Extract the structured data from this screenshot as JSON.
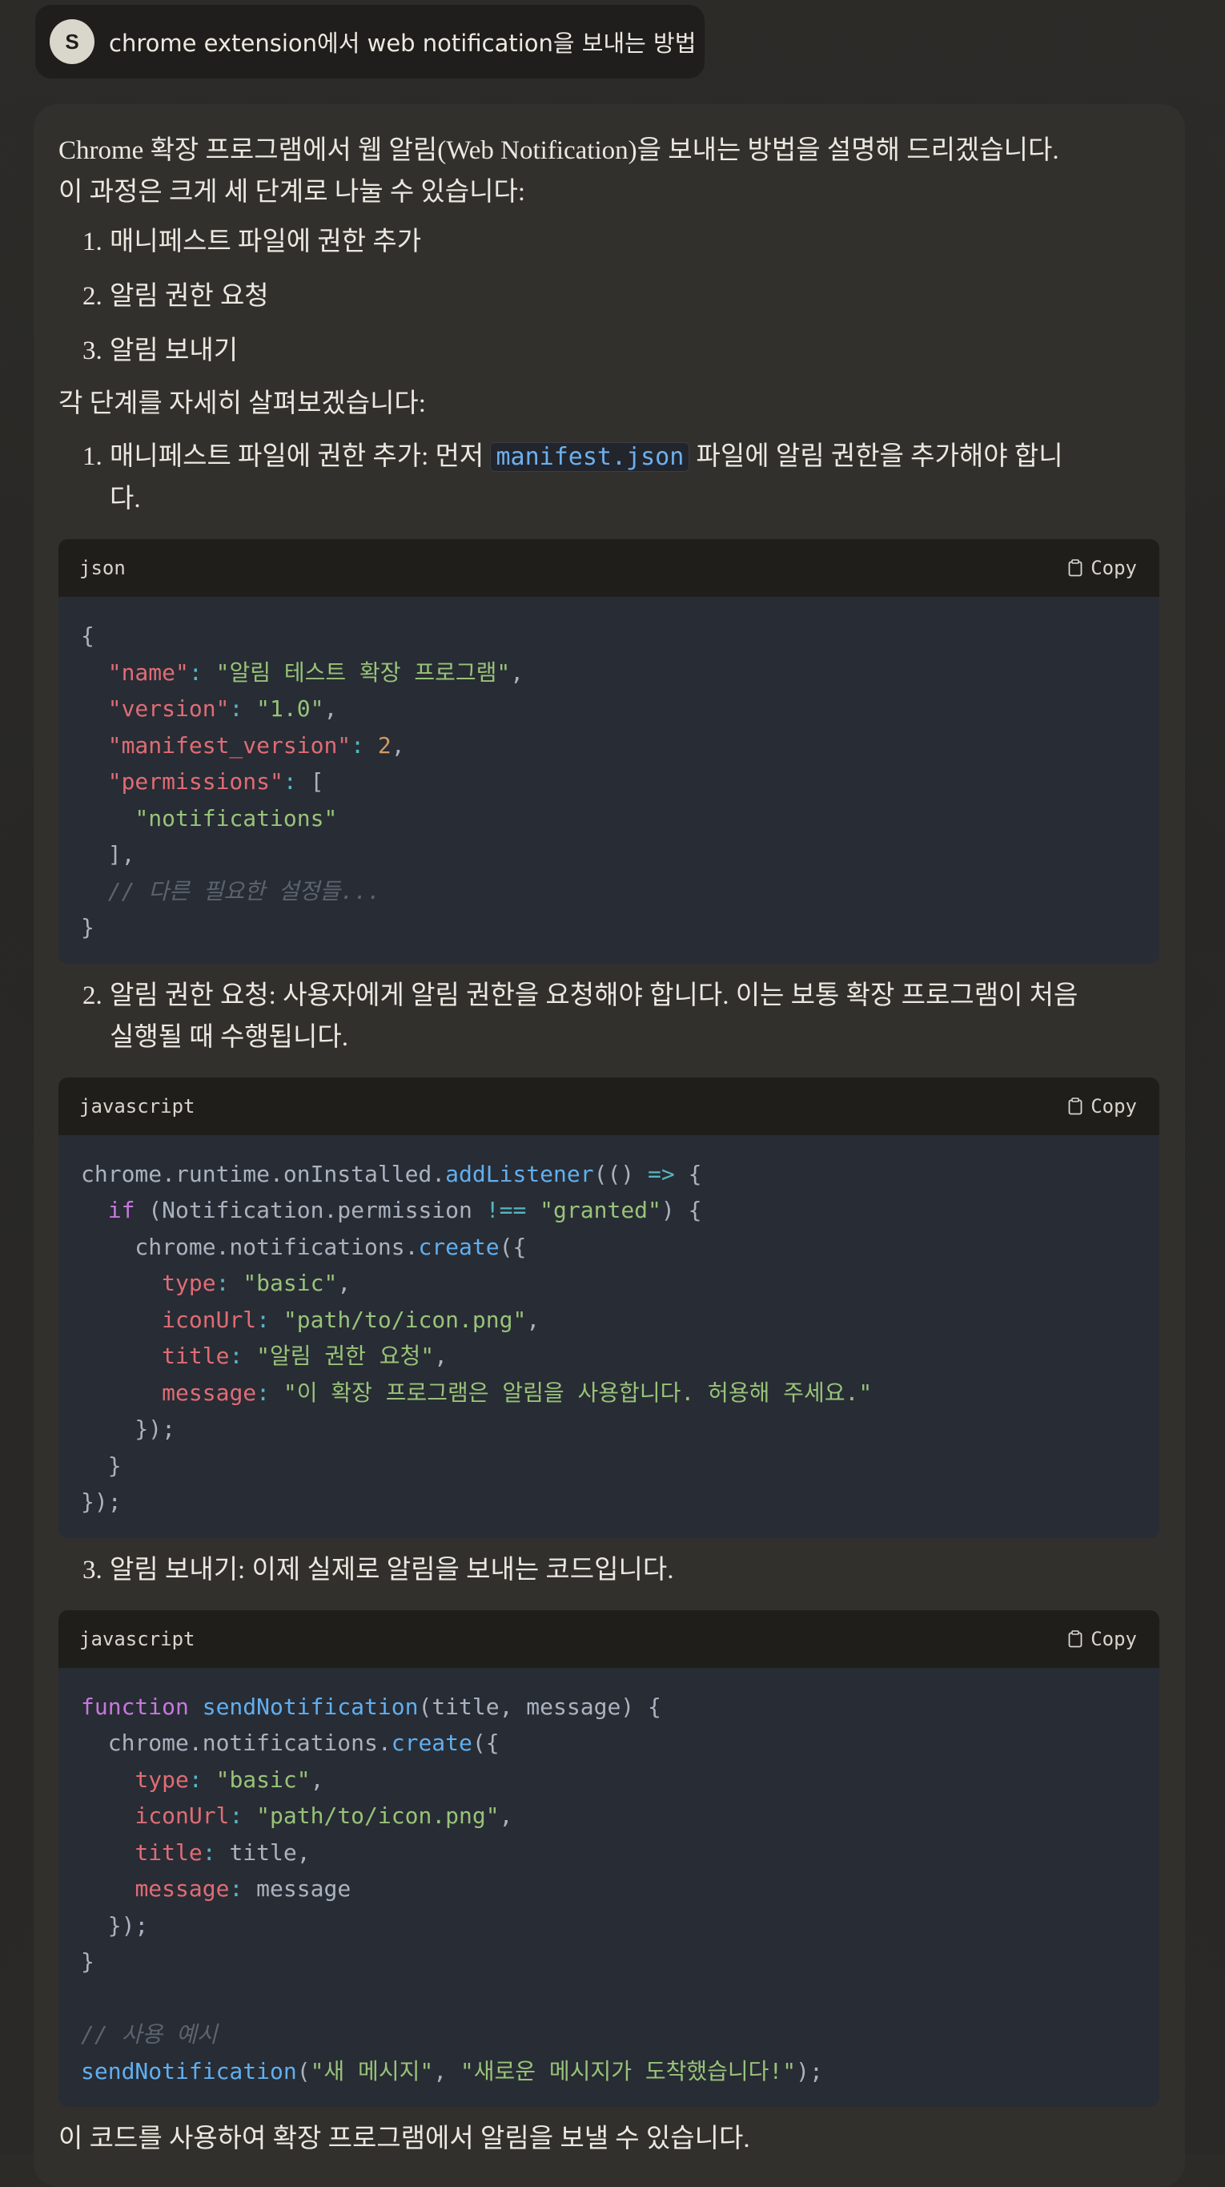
{
  "user_message": {
    "avatar_initial": "S",
    "text": "chrome extension에서 web notification을 보내는 방법"
  },
  "assistant": {
    "intro_line1": "Chrome 확장 프로그램에서 웹 알림(Web Notification)을 보내는 방법을 설명해 드리겠습니다.",
    "intro_line2": "이 과정은 크게 세 단계로 나눌 수 있습니다:",
    "overview": [
      {
        "num": "1.",
        "text": "매니페스트 파일에 권한 추가"
      },
      {
        "num": "2.",
        "text": "알림 권한 요청"
      },
      {
        "num": "3.",
        "text": "알림 보내기"
      }
    ],
    "detail_intro": "각 단계를 자세히 살펴보겠습니다:",
    "step1": {
      "num": "1.",
      "text_before": "매니페스트 파일에 권한 추가: 먼저",
      "inline_code": "manifest.json",
      "text_after": "파일에 알림 권한을 추가해야 합니",
      "text_wrap": "다."
    },
    "step2": {
      "num": "2.",
      "text_line1": "알림 권한 요청: 사용자에게 알림 권한을 요청해야 합니다. 이는 보통 확장 프로그램이 처음",
      "text_line2": "실행될 때 수행됩니다."
    },
    "step3": {
      "num": "3.",
      "text": "알림 보내기: 이제 실제로 알림을 보내는 코드입니다."
    },
    "bottom_partial": "이 코드를 사용하여 확장 프로그램에서 알림을 보낼 수 있습니다."
  },
  "code_blocks": [
    {
      "language": "json",
      "copy_label": "Copy",
      "lines": [
        [
          [
            "t-pl",
            "{"
          ]
        ],
        [
          [
            "t-pl",
            "  "
          ],
          [
            "t-key",
            "\"name\""
          ],
          [
            "t-op",
            ":"
          ],
          [
            "t-pl",
            " "
          ],
          [
            "t-str",
            "\"알림 테스트 확장 프로그램\""
          ],
          [
            "t-pl",
            ","
          ]
        ],
        [
          [
            "t-pl",
            "  "
          ],
          [
            "t-key",
            "\"version\""
          ],
          [
            "t-op",
            ":"
          ],
          [
            "t-pl",
            " "
          ],
          [
            "t-str",
            "\"1.0\""
          ],
          [
            "t-pl",
            ","
          ]
        ],
        [
          [
            "t-pl",
            "  "
          ],
          [
            "t-key",
            "\"manifest_version\""
          ],
          [
            "t-op",
            ":"
          ],
          [
            "t-pl",
            " "
          ],
          [
            "t-num",
            "2"
          ],
          [
            "t-pl",
            ","
          ]
        ],
        [
          [
            "t-pl",
            "  "
          ],
          [
            "t-key",
            "\"permissions\""
          ],
          [
            "t-op",
            ":"
          ],
          [
            "t-pl",
            " ["
          ]
        ],
        [
          [
            "t-pl",
            "    "
          ],
          [
            "t-str",
            "\"notifications\""
          ]
        ],
        [
          [
            "t-pl",
            "  ],"
          ]
        ],
        [
          [
            "t-pl",
            "  "
          ],
          [
            "t-cmt",
            "// 다른 필요한 설정들..."
          ]
        ],
        [
          [
            "t-pl",
            "}"
          ]
        ]
      ]
    },
    {
      "language": "javascript",
      "copy_label": "Copy",
      "lines": [
        [
          [
            "t-pl",
            "chrome.runtime.onInstalled."
          ],
          [
            "t-fn",
            "addListener"
          ],
          [
            "t-pl",
            "(() "
          ],
          [
            "t-op",
            "=>"
          ],
          [
            "t-pl",
            " {"
          ]
        ],
        [
          [
            "t-pl",
            "  "
          ],
          [
            "t-kw",
            "if"
          ],
          [
            "t-pl",
            " (Notification.permission "
          ],
          [
            "t-op",
            "!=="
          ],
          [
            "t-pl",
            " "
          ],
          [
            "t-str",
            "\"granted\""
          ],
          [
            "t-pl",
            ") {"
          ]
        ],
        [
          [
            "t-pl",
            "    chrome.notifications."
          ],
          [
            "t-fn",
            "create"
          ],
          [
            "t-pl",
            "({"
          ]
        ],
        [
          [
            "t-pl",
            "      "
          ],
          [
            "t-key",
            "type"
          ],
          [
            "t-op",
            ":"
          ],
          [
            "t-pl",
            " "
          ],
          [
            "t-str",
            "\"basic\""
          ],
          [
            "t-pl",
            ","
          ]
        ],
        [
          [
            "t-pl",
            "      "
          ],
          [
            "t-key",
            "iconUrl"
          ],
          [
            "t-op",
            ":"
          ],
          [
            "t-pl",
            " "
          ],
          [
            "t-str",
            "\"path/to/icon.png\""
          ],
          [
            "t-pl",
            ","
          ]
        ],
        [
          [
            "t-pl",
            "      "
          ],
          [
            "t-key",
            "title"
          ],
          [
            "t-op",
            ":"
          ],
          [
            "t-pl",
            " "
          ],
          [
            "t-str",
            "\"알림 권한 요청\""
          ],
          [
            "t-pl",
            ","
          ]
        ],
        [
          [
            "t-pl",
            "      "
          ],
          [
            "t-key",
            "message"
          ],
          [
            "t-op",
            ":"
          ],
          [
            "t-pl",
            " "
          ],
          [
            "t-str",
            "\"이 확장 프로그램은 알림을 사용합니다. 허용해 주세요.\""
          ]
        ],
        [
          [
            "t-pl",
            "    });"
          ]
        ],
        [
          [
            "t-pl",
            "  }"
          ]
        ],
        [
          [
            "t-pl",
            "});"
          ]
        ]
      ]
    },
    {
      "language": "javascript",
      "copy_label": "Copy",
      "lines": [
        [
          [
            "t-kw",
            "function"
          ],
          [
            "t-pl",
            " "
          ],
          [
            "t-fn",
            "sendNotification"
          ],
          [
            "t-pl",
            "(title, message) {"
          ]
        ],
        [
          [
            "t-pl",
            "  chrome.notifications."
          ],
          [
            "t-fn",
            "create"
          ],
          [
            "t-pl",
            "({"
          ]
        ],
        [
          [
            "t-pl",
            "    "
          ],
          [
            "t-key",
            "type"
          ],
          [
            "t-op",
            ":"
          ],
          [
            "t-pl",
            " "
          ],
          [
            "t-str",
            "\"basic\""
          ],
          [
            "t-pl",
            ","
          ]
        ],
        [
          [
            "t-pl",
            "    "
          ],
          [
            "t-key",
            "iconUrl"
          ],
          [
            "t-op",
            ":"
          ],
          [
            "t-pl",
            " "
          ],
          [
            "t-str",
            "\"path/to/icon.png\""
          ],
          [
            "t-pl",
            ","
          ]
        ],
        [
          [
            "t-pl",
            "    "
          ],
          [
            "t-key",
            "title"
          ],
          [
            "t-op",
            ":"
          ],
          [
            "t-pl",
            " title,"
          ]
        ],
        [
          [
            "t-pl",
            "    "
          ],
          [
            "t-key",
            "message"
          ],
          [
            "t-op",
            ":"
          ],
          [
            "t-pl",
            " message"
          ]
        ],
        [
          [
            "t-pl",
            "  });"
          ]
        ],
        [
          [
            "t-pl",
            "}"
          ]
        ],
        [
          [
            "t-pl",
            ""
          ]
        ],
        [
          [
            "t-cmt",
            "// 사용 예시"
          ]
        ],
        [
          [
            "t-fn",
            "sendNotification"
          ],
          [
            "t-pl",
            "("
          ],
          [
            "t-str",
            "\"새 메시지\""
          ],
          [
            "t-pl",
            ", "
          ],
          [
            "t-str",
            "\"새로운 메시지가 도착했습니다!\""
          ],
          [
            "t-pl",
            ");"
          ]
        ]
      ]
    }
  ],
  "colors": {
    "background": "#2a2927",
    "card": "#31302d",
    "code_bg": "#282c34",
    "code_header": "#1f1e1b",
    "inline_code": "#6cb0f0",
    "syntax_key": "#e06c75",
    "syntax_string": "#98c379",
    "syntax_number": "#d19a66",
    "syntax_function": "#61afef",
    "syntax_keyword": "#c678dd",
    "syntax_comment": "#5c6370"
  },
  "icons": {
    "copy": "clipboard-icon"
  }
}
